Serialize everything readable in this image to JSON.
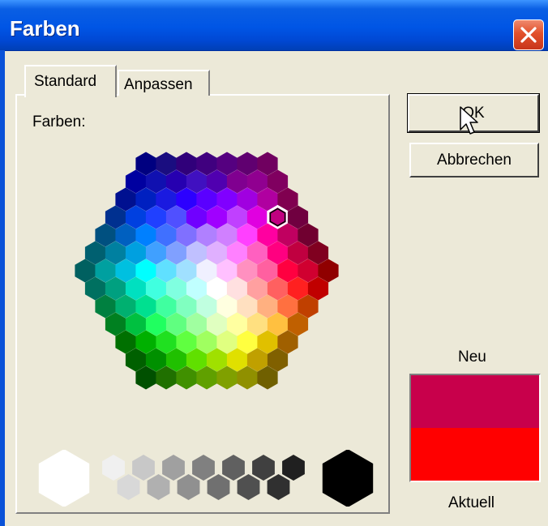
{
  "window": {
    "title": "Farben"
  },
  "tabs": [
    {
      "label": "Standard"
    },
    {
      "label": "Anpassen"
    }
  ],
  "palette": {
    "label": "Farben:",
    "rows": [
      [
        "#000080",
        "#1a0d80",
        "#30007a",
        "#40007f",
        "#550080",
        "#600070",
        "#700060"
      ],
      [
        "#0000a0",
        "#1010b0",
        "#2600b0",
        "#4010c0",
        "#5000b0",
        "#800090",
        "#900090",
        "#800060"
      ],
      [
        "#001090",
        "#0020c0",
        "#1a1ae0",
        "#2c00ff",
        "#5a00ff",
        "#8000ff",
        "#a000e0",
        "#b000a0",
        "#800050"
      ],
      [
        "#003090",
        "#0040e0",
        "#2040ff",
        "#5050ff",
        "#7000ff",
        "#a000ff",
        "#c040ff",
        "#e000e0",
        "#c00080",
        "#700040"
      ],
      [
        "#005080",
        "#0060c0",
        "#0080ff",
        "#4070ff",
        "#8070ff",
        "#b080ff",
        "#d080ff",
        "#ff40ff",
        "#ff00a0",
        "#c00060",
        "#700030"
      ],
      [
        "#006070",
        "#0080a0",
        "#00a0e0",
        "#40a0ff",
        "#80a0ff",
        "#c0c0ff",
        "#e0b0ff",
        "#ff80ff",
        "#ff60c0",
        "#ff0080",
        "#c00040",
        "#800020"
      ],
      [
        "#006060",
        "#00a0a0",
        "#00c0e0",
        "#00ffff",
        "#60e0ff",
        "#a0e0ff",
        "#f0f0ff",
        "#ffc0ff",
        "#ff90c0",
        "#ff60a0",
        "#ff0040",
        "#d00030",
        "#900000"
      ],
      [
        "#007060",
        "#00a080",
        "#00e0c0",
        "#40ffe0",
        "#80ffe0",
        "#c0ffff",
        "#ffffff",
        "#ffe0e0",
        "#ffa0a0",
        "#ff6060",
        "#ff2020",
        "#c00000"
      ],
      [
        "#008040",
        "#00b070",
        "#00e090",
        "#40ffa0",
        "#80ffc0",
        "#c0ffe0",
        "#ffffe0",
        "#ffe0c0",
        "#ffb080",
        "#ff7040",
        "#c04000"
      ],
      [
        "#008020",
        "#00c040",
        "#20ff60",
        "#60ff80",
        "#a0ffa0",
        "#e0ffc0",
        "#ffffa0",
        "#ffe080",
        "#ffc040",
        "#c06000"
      ],
      [
        "#007000",
        "#00b000",
        "#20e020",
        "#60ff40",
        "#a0ff60",
        "#e0ff80",
        "#ffff40",
        "#e0c000",
        "#a06000"
      ],
      [
        "#006000",
        "#009000",
        "#20c000",
        "#60e000",
        "#a0e000",
        "#e0e000",
        "#c0a000",
        "#806000"
      ],
      [
        "#005000",
        "#207000",
        "#409000",
        "#60a000",
        "#80a000",
        "#909000",
        "#706000"
      ]
    ],
    "selected": {
      "row": 3,
      "col": 8
    }
  },
  "grays": {
    "small": [
      "#f0f0f0",
      "#d8d8d8",
      "#c8c8c8",
      "#b0b0b0",
      "#a0a0a0",
      "#909090",
      "#808080",
      "#707070",
      "#606060",
      "#505050",
      "#404040",
      "#303030",
      "#202020"
    ],
    "white": "#ffffff",
    "black": "#000000"
  },
  "buttons": {
    "ok": "OK",
    "cancel": "Abbrechen"
  },
  "preview": {
    "new_label": "Neu",
    "current_label": "Aktuell",
    "new_color": "#c8004b",
    "current_color": "#ff0000"
  }
}
